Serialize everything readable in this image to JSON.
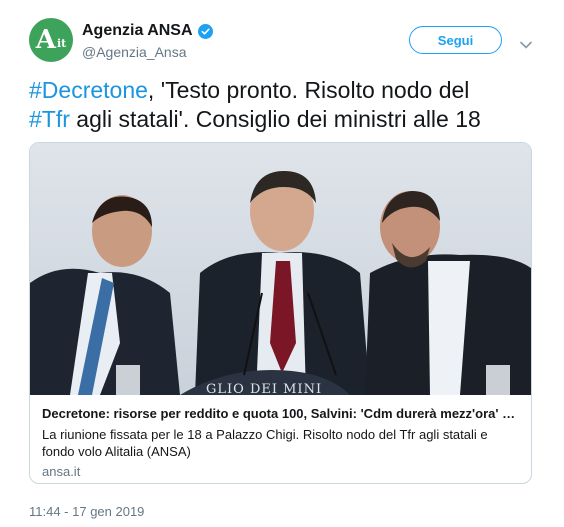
{
  "account": {
    "display_name": "Agenzia ANSA",
    "handle": "@Agenzia_Ansa",
    "avatar_letter": "A",
    "avatar_suffix": "it",
    "brand_color": "#3da35a",
    "verified_color": "#1da1f2"
  },
  "actions": {
    "follow_label": "Segui",
    "caret_icon": "chevron-down-icon"
  },
  "tweet": {
    "tag1": "#Decretone",
    "text1": ", 'Testo pronto. Risolto nodo del",
    "tag2": "#Tfr",
    "text2": " agli statali'.  Consiglio dei ministri alle 18",
    "link_color": "#1b95e0"
  },
  "card": {
    "image_podium_text": "GLIO DEI MINI",
    "title": "Decretone: risorse per reddito e quota 100, Salvini: 'Cdm durerà mezz'ora' - P...",
    "description": "La riunione fissata per le 18 a Palazzo Chigi. Risolto nodo del Tfr agli statali e fondo volo Alitalia (ANSA)",
    "domain": "ansa.it"
  },
  "timestamp": "11:44 - 17 gen 2019"
}
